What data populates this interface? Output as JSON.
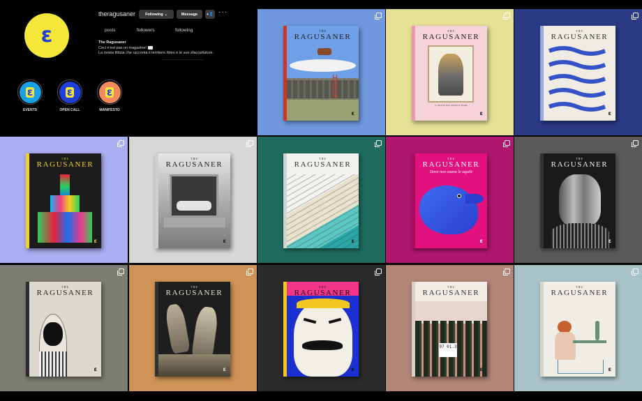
{
  "profile": {
    "username": "theragusaner",
    "following_label": "Following",
    "message_label": "Message",
    "add_label": "+",
    "more_label": "···",
    "stats": {
      "posts": "posts",
      "followers": "followers",
      "following": "following"
    },
    "bio_name": "The Ragusaner",
    "bio_line1": "Ceci n'est pas un magazine!",
    "bio_line2": "La rivista fittizia che racconta il territorio Ibleo e le sue sfaccettature.",
    "logo_glyph": "ε",
    "avatar_color": "#f5e63a",
    "logo_color": "#1f3fd8"
  },
  "highlights": [
    {
      "label": "EVENTS",
      "bg": "#1aa0e6",
      "glyph_bg": "#f5e63a"
    },
    {
      "label": "OPEN CALL",
      "bg": "#1f3fd8",
      "glyph_bg": "#f5e63a"
    },
    {
      "label": "MANIFESTO",
      "bg": "#f2895e",
      "glyph_bg": "#f5e63a"
    }
  ],
  "magazine": {
    "the": "THE",
    "title": "RAGUSANER"
  },
  "covers": [
    {
      "bg": "#6f98de",
      "cover": "#dcdad2",
      "spine": "#c9372c",
      "ink": "#2a2a2a",
      "subject": "cows-over-stone-wall"
    },
    {
      "bg": "#e7e196",
      "cover": "#f5d3d8",
      "spine": "#e89aa8",
      "ink": "#222",
      "subject": "fish-head-portrait",
      "strip": "IL PESCE DEL MARE D'IBLEA"
    },
    {
      "bg": "#2a3a86",
      "cover": "#efece4",
      "spine": "#9aa8d8",
      "ink": "#333",
      "subject": "blue-waves-text"
    },
    {
      "bg": "#aaaef2",
      "cover": "#1c1c1c",
      "spine": "#f0d020",
      "ink": "#f0d020",
      "subject": "neon-church"
    },
    {
      "bg": "#d7d7d7",
      "cover": "#e8e8e8",
      "spine": "#cfcfcf",
      "ink": "#333",
      "subject": "window-sleeper"
    },
    {
      "bg": "#1f6b5e",
      "cover": "#f2f2ef",
      "spine": "#cfd6d2",
      "ink": "#333",
      "subject": "beach-map"
    },
    {
      "bg": "#b0176f",
      "cover": "#e2117e",
      "spine": "#a8105e",
      "ink": "#fff",
      "subject": "blue-eagle",
      "tagline": "Dove non osano le aquile"
    },
    {
      "bg": "#5a5a5a",
      "cover": "#1a1a1a",
      "spine": "#333",
      "ink": "#eee",
      "subject": "collage-face"
    },
    {
      "bg": "#7d7d73",
      "cover": "#dcd8cd",
      "spine": "#2e2e2e",
      "ink": "#2a2a2a",
      "subject": "woman-portrait"
    },
    {
      "bg": "#cf9355",
      "cover": "#1e1e1e",
      "spine": "#333",
      "ink": "#e8e2d2",
      "subject": "dancers"
    },
    {
      "bg": "#2b2b2b",
      "cover": "#1c2fd0",
      "spine": "#f0c820",
      "ink": "#111",
      "subject": "mustache-face"
    },
    {
      "bg": "#b28576",
      "cover": "#f1ece6",
      "spine": "#d9cfc6",
      "ink": "#333",
      "subject": "forest-sign",
      "sign": "97 01.3"
    },
    {
      "bg": "#a9c4c9",
      "cover": "#f0ede6",
      "spine": "#d6d3cb",
      "ink": "#333",
      "subject": "woman-at-table"
    }
  ]
}
